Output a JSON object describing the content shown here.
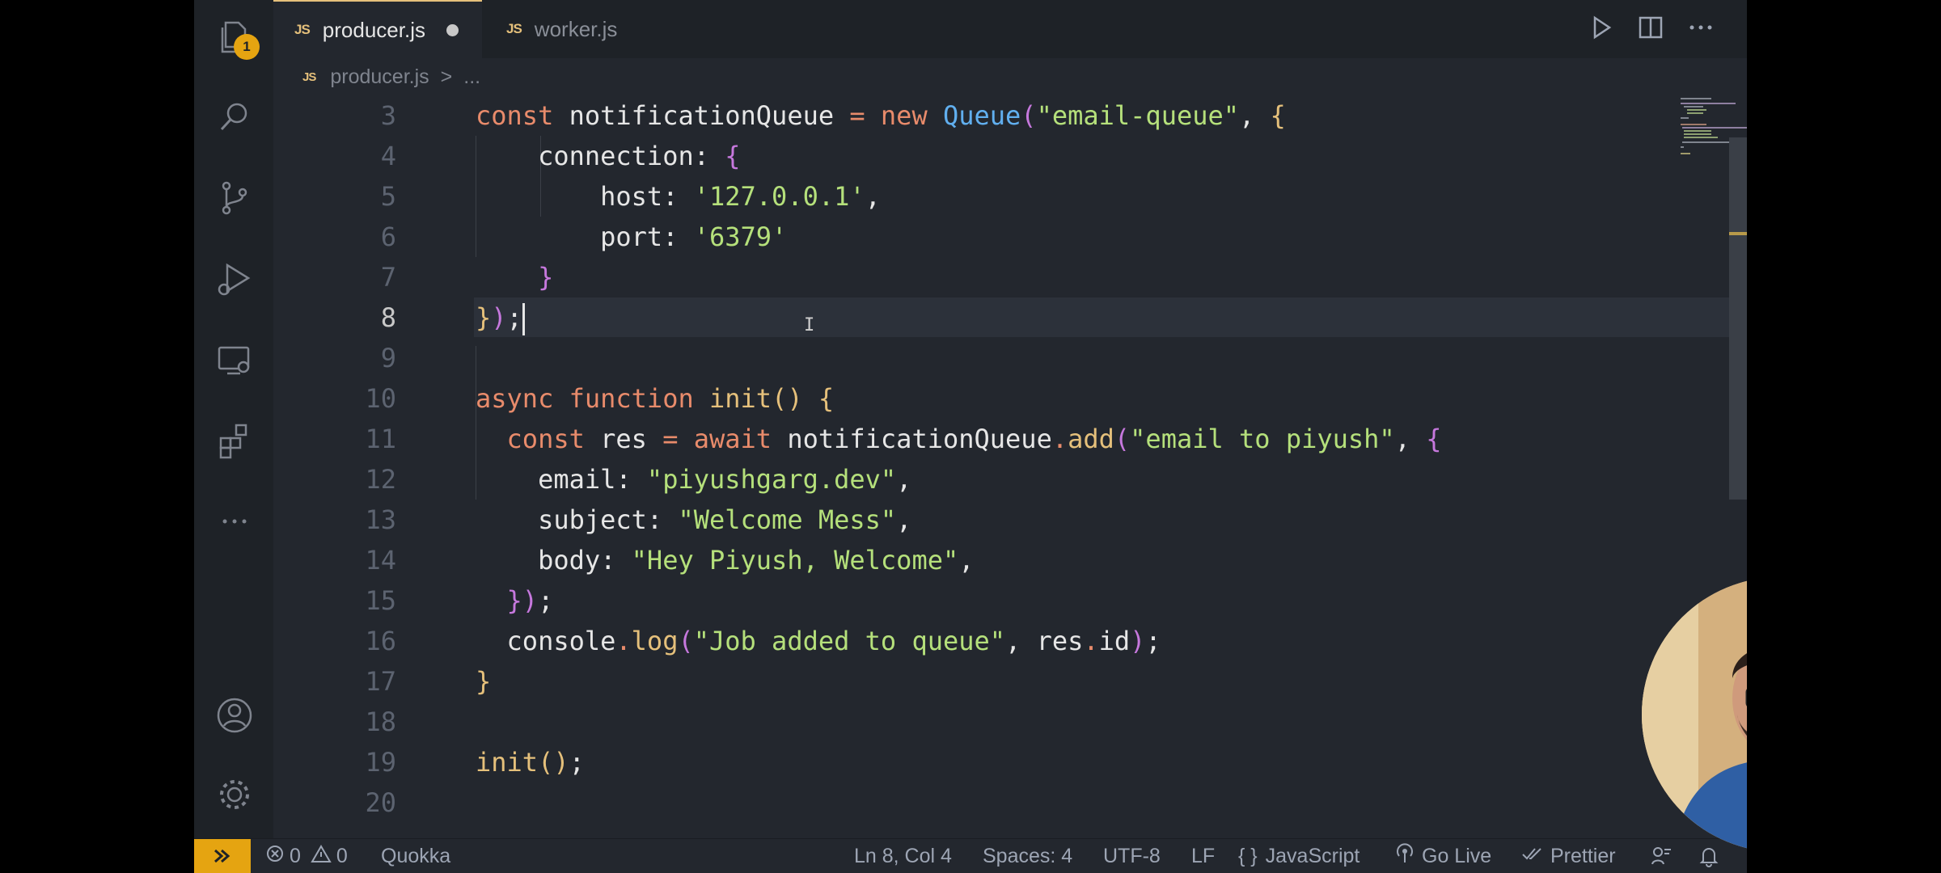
{
  "window": {
    "title": "producer.js"
  },
  "activity_bar": {
    "explorer_badge": "1",
    "icons": [
      "files-icon",
      "search-icon",
      "source-control-icon",
      "run-debug-icon",
      "remote-explorer-icon",
      "extensions-icon",
      "more-icon",
      "account-icon",
      "settings-gear-icon"
    ]
  },
  "tabs": [
    {
      "label": "producer.js",
      "icon_text": "JS",
      "active": true,
      "dirty": true
    },
    {
      "label": "worker.js",
      "icon_text": "JS",
      "active": false,
      "dirty": false
    }
  ],
  "breadcrumb": {
    "icon_text": "JS",
    "file": "producer.js",
    "separator": ">",
    "rest": "..."
  },
  "editor": {
    "line_numbers": [
      "3",
      "4",
      "5",
      "6",
      "7",
      "8",
      "9",
      "10",
      "11",
      "12",
      "13",
      "14",
      "15",
      "16",
      "17",
      "18",
      "19",
      "20"
    ],
    "current_line": "8"
  },
  "status_bar": {
    "errors": "0",
    "warnings": "0",
    "quokka": "Quokka",
    "position": "Ln 8, Col 4",
    "spaces": "Spaces: 4",
    "encoding": "UTF-8",
    "eol": "LF",
    "language": "JavaScript",
    "language_icon": "{ }",
    "go_live": "Go Live",
    "prettier": "Prettier"
  },
  "colors": {
    "accent": "#e5a411",
    "editor_bg": "#23272e",
    "keyword": "#e88b6b",
    "string": "#b5e07b",
    "class": "#61afef"
  }
}
